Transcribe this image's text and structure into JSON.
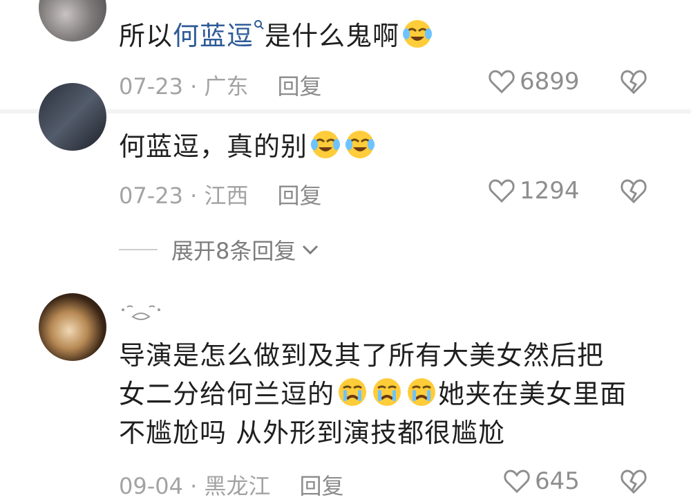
{
  "comments": [
    {
      "prefix": "所以",
      "link": "何蓝逗",
      "suffix": "是什么鬼啊",
      "meta": "07-23 · 广东",
      "reply_label": "回复",
      "likes": "6899"
    },
    {
      "text": "何蓝逗，真的别",
      "meta": "07-23 · 江西",
      "reply_label": "回复",
      "likes": "1294"
    },
    {
      "line1": "导演是怎么做到及其了所有大美女然后把",
      "line2a": "女二分给何兰逗的",
      "line2b": "她夹在美女里面",
      "line3": "不尴尬吗 从外形到演技都很尴尬",
      "meta": "09-04 · 黑龙江",
      "reply_label": "回复",
      "likes": "645"
    }
  ],
  "expand": {
    "label": "展开8条回复"
  },
  "icons": {
    "search": "search-icon",
    "emoji_laugh_cry": "laugh-cry-emoji",
    "emoji_crying": "crying-emoji",
    "like": "heart-outline-icon",
    "dislike": "broken-heart-icon",
    "expand": "chevron-down-icon"
  },
  "colors": {
    "link": "#2e5b97",
    "meta": "#a3a3a3",
    "icon": "#8e8e8e"
  }
}
